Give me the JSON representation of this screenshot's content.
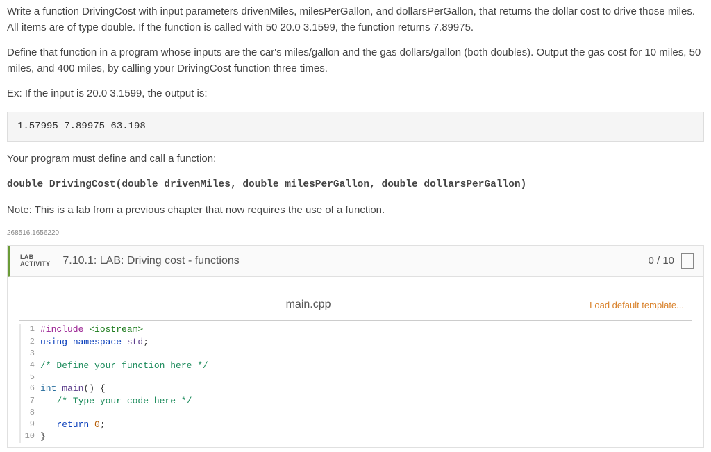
{
  "instructions": {
    "p1": "Write a function DrivingCost with input parameters drivenMiles, milesPerGallon, and dollarsPerGallon, that returns the dollar cost to drive those miles. All items are of type double. If the function is called with 50 20.0 3.1599, the function returns 7.89975.",
    "p2": "Define that function in a program whose inputs are the car's miles/gallon and the gas dollars/gallon (both doubles). Output the gas cost for 10 miles, 50 miles, and 400 miles, by calling your DrivingCost function three times.",
    "p3": "Ex: If the input is 20.0 3.1599, the output is:",
    "output_example": "1.57995 7.89975 63.198",
    "p4": "Your program must define and call a function:",
    "signature": "double DrivingCost(double drivenMiles, double milesPerGallon, double dollarsPerGallon)",
    "p5": "Note: This is a lab from a previous chapter that now requires the use of a function.",
    "small_id": "268516.1656220"
  },
  "activity": {
    "lab_label_1": "LAB",
    "lab_label_2": "ACTIVITY",
    "title": "7.10.1: LAB: Driving cost - functions",
    "score": "0 / 10",
    "filename": "main.cpp",
    "load_template": "Load default template..."
  },
  "code_lines": [
    {
      "n": "1",
      "tokens": [
        [
          "tok-pre",
          "#include "
        ],
        [
          "tok-str",
          "<iostream>"
        ]
      ]
    },
    {
      "n": "2",
      "tokens": [
        [
          "tok-kw",
          "using "
        ],
        [
          "tok-kw",
          "namespace "
        ],
        [
          "tok-id",
          "std"
        ],
        [
          "",
          ";"
        ]
      ]
    },
    {
      "n": "3",
      "tokens": [
        [
          "",
          ""
        ]
      ]
    },
    {
      "n": "4",
      "tokens": [
        [
          "tok-com",
          "/* Define your function here */"
        ]
      ]
    },
    {
      "n": "5",
      "tokens": [
        [
          "",
          ""
        ]
      ]
    },
    {
      "n": "6",
      "tokens": [
        [
          "tok-type",
          "int "
        ],
        [
          "tok-id",
          "main"
        ],
        [
          "",
          "() {"
        ]
      ]
    },
    {
      "n": "7",
      "tokens": [
        [
          "",
          "   "
        ],
        [
          "tok-com",
          "/* Type your code here */"
        ]
      ]
    },
    {
      "n": "8",
      "tokens": [
        [
          "",
          ""
        ]
      ]
    },
    {
      "n": "9",
      "tokens": [
        [
          "",
          "   "
        ],
        [
          "tok-kw",
          "return "
        ],
        [
          "tok-num",
          "0"
        ],
        [
          "",
          ";"
        ]
      ]
    },
    {
      "n": "10",
      "tokens": [
        [
          "",
          "}"
        ]
      ]
    }
  ]
}
